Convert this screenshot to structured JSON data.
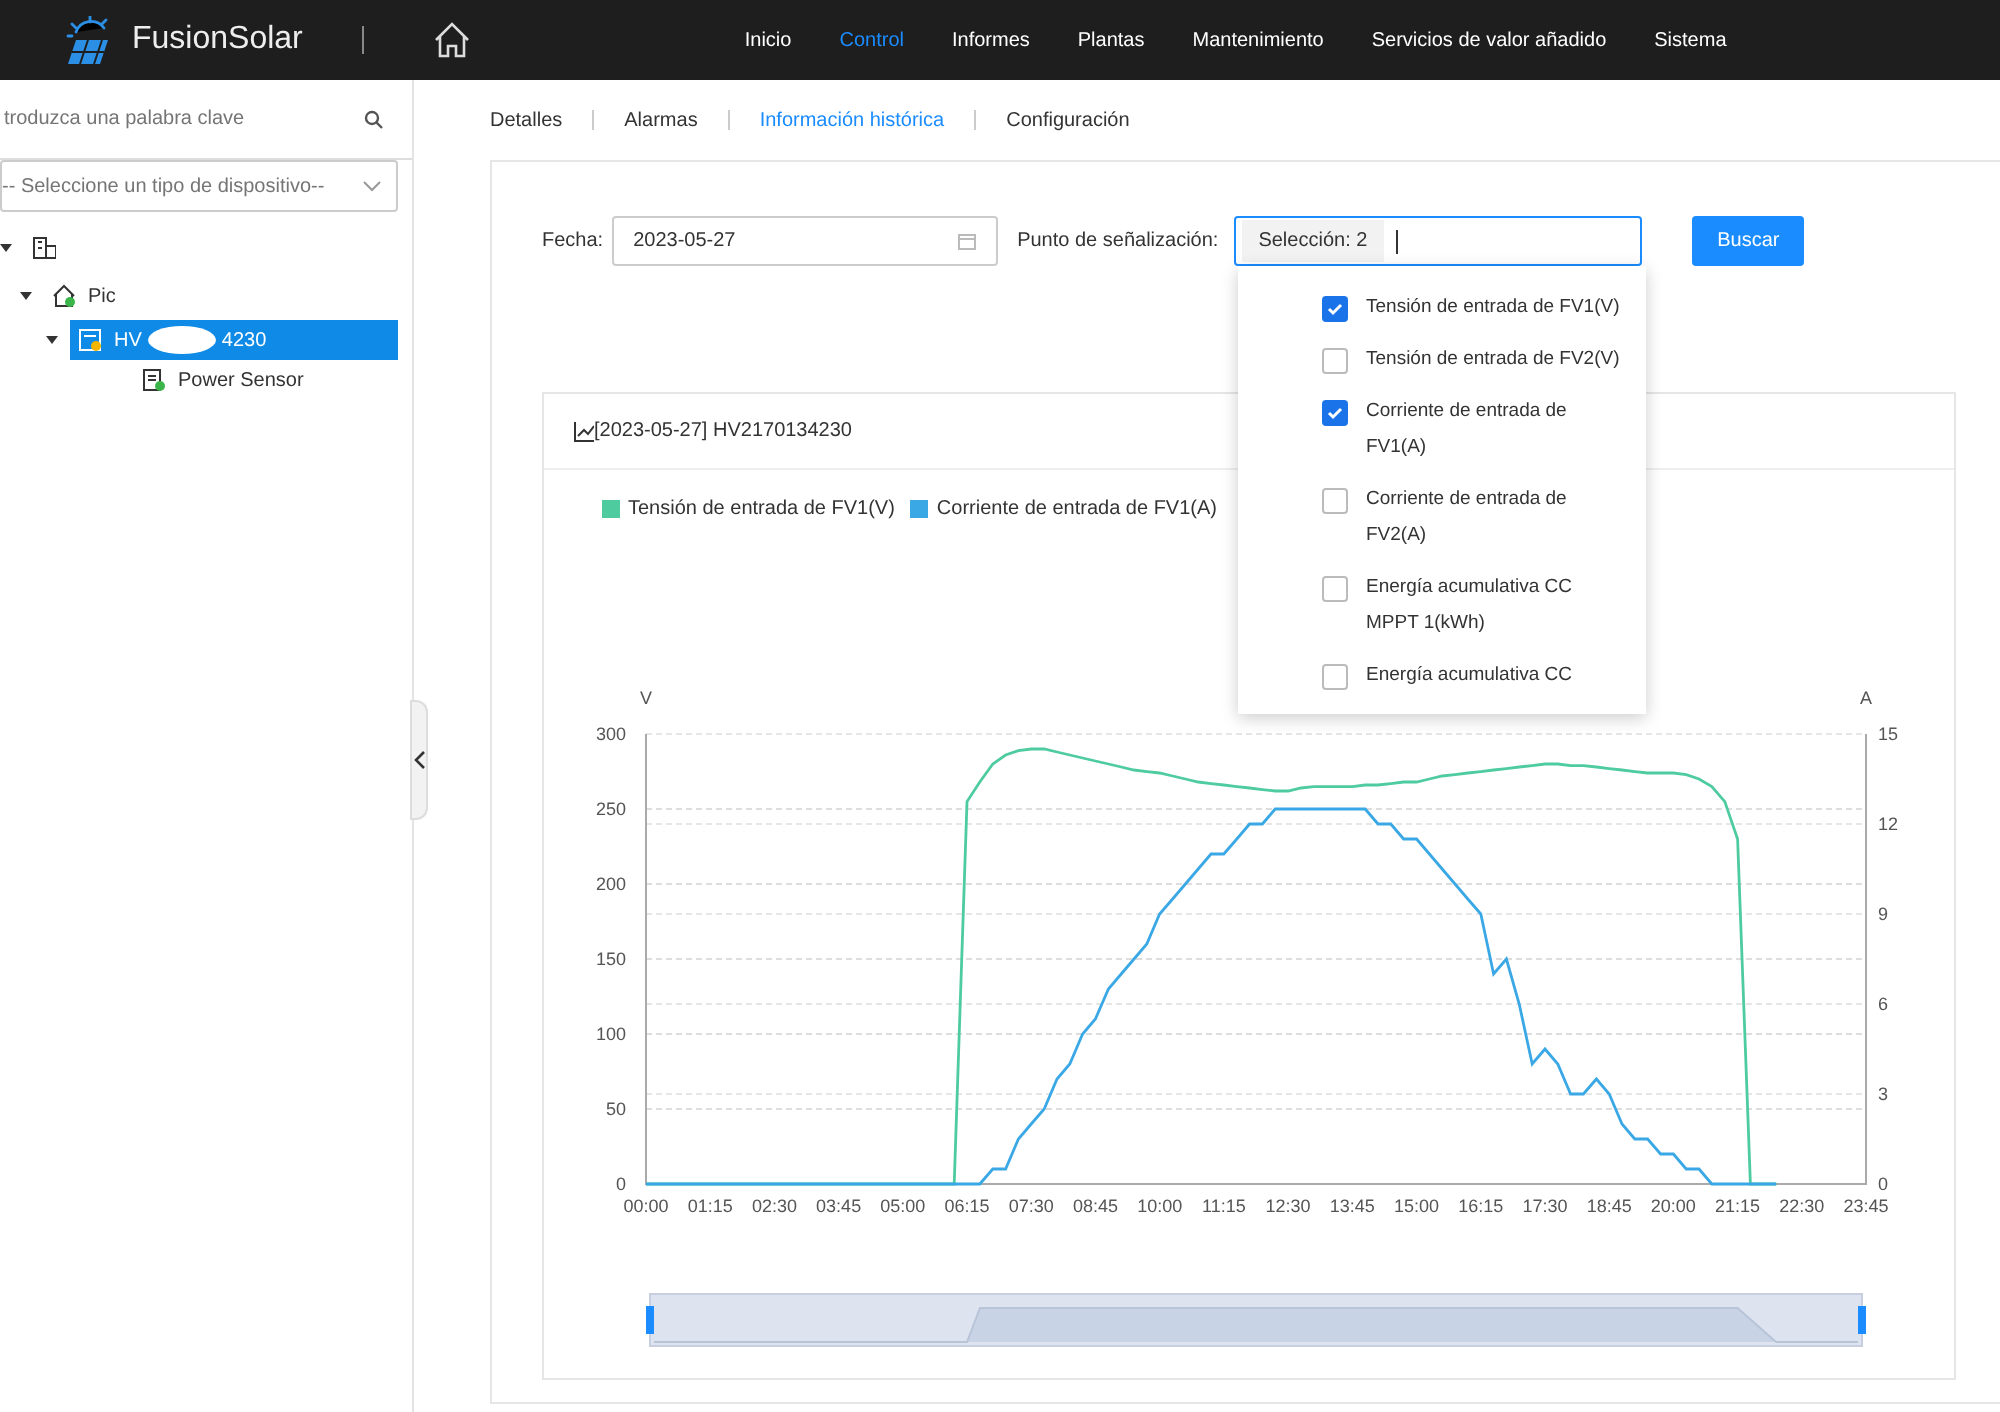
{
  "header": {
    "logo_text": "FusionSolar",
    "nav": [
      {
        "label": "Inicio",
        "selected": false
      },
      {
        "label": "Control",
        "selected": true
      },
      {
        "label": "Informes",
        "selected": false
      },
      {
        "label": "Plantas",
        "selected": false
      },
      {
        "label": "Mantenimiento",
        "selected": false
      },
      {
        "label": "Servicios de valor añadido",
        "selected": false
      },
      {
        "label": "Sistema",
        "selected": false
      }
    ]
  },
  "sidebar": {
    "search": {
      "placeholder": "troduzca una palabra clave"
    },
    "device_type": {
      "placeholder": "-- Seleccione un tipo de dispositivo--"
    },
    "tree": [
      {
        "kind": "building",
        "expanded": true,
        "selected": false,
        "children": [
          {
            "kind": "plant",
            "label": "Pic",
            "expanded": true,
            "selected": false,
            "children": [
              {
                "kind": "inverter",
                "label": "HV",
                "label_end": "4230",
                "expanded": true,
                "selected": true,
                "children": [
                  {
                    "kind": "sensor",
                    "label": "Power Sensor",
                    "selected": false
                  }
                ]
              }
            ]
          }
        ]
      }
    ]
  },
  "tabs": [
    {
      "label": "Detalles",
      "selected": false
    },
    {
      "label": "Alarmas",
      "selected": false
    },
    {
      "label": "Información histórica",
      "selected": true
    },
    {
      "label": "Configuración",
      "selected": false
    }
  ],
  "filters": {
    "date_label": "Fecha:",
    "date": "2023-05-27",
    "signal_label": "Punto de señalización:",
    "signal_value": "Selección: 2",
    "search_button": "Buscar",
    "options": [
      {
        "label": "Tensión de entrada de FV1(V)",
        "checked": true
      },
      {
        "label": "Tensión de entrada de FV2(V)",
        "checked": false
      },
      {
        "label": "Corriente de entrada de FV1(A)",
        "checked": true
      },
      {
        "label": "Corriente de entrada de FV2(A)",
        "checked": false
      },
      {
        "label": "Energía acumulativa CC MPPT 1(kWh)",
        "checked": false
      },
      {
        "label": "Energía acumulativa CC",
        "checked": false
      }
    ]
  },
  "chart_card": {
    "title": "[2023-05-27] HV2170134230",
    "chart_data": {
      "type": "line",
      "ylabel": "V",
      "y2label": "A",
      "ylim": [
        0,
        300
      ],
      "yticks": [
        0,
        50,
        100,
        150,
        200,
        250,
        300
      ],
      "y2lim": [
        0,
        15
      ],
      "y2ticks": [
        0,
        3,
        6,
        9,
        12,
        15
      ],
      "xlim": [
        0,
        23.75
      ],
      "grid": true,
      "xticks": [
        {
          "value": 0,
          "label": "00:00"
        },
        {
          "value": 1.25,
          "label": "01:15"
        },
        {
          "value": 2.5,
          "label": "02:30"
        },
        {
          "value": 3.75,
          "label": "03:45"
        },
        {
          "value": 5,
          "label": "05:00"
        },
        {
          "value": 6.25,
          "label": "06:15"
        },
        {
          "value": 7.5,
          "label": "07:30"
        },
        {
          "value": 8.75,
          "label": "08:45"
        },
        {
          "value": 10,
          "label": "10:00"
        },
        {
          "value": 11.25,
          "label": "11:15"
        },
        {
          "value": 12.5,
          "label": "12:30"
        },
        {
          "value": 13.75,
          "label": "13:45"
        },
        {
          "value": 15,
          "label": "15:00"
        },
        {
          "value": 16.25,
          "label": "16:15"
        },
        {
          "value": 17.5,
          "label": "17:30"
        },
        {
          "value": 18.75,
          "label": "18:45"
        },
        {
          "value": 20,
          "label": "20:00"
        },
        {
          "value": 21.25,
          "label": "21:15"
        },
        {
          "value": 22.5,
          "label": "22:30"
        },
        {
          "value": 23.75,
          "label": "23:45"
        }
      ],
      "x": [
        0,
        0.25,
        0.5,
        0.75,
        1,
        1.25,
        1.5,
        1.75,
        2,
        2.25,
        2.5,
        2.75,
        3,
        3.25,
        3.5,
        3.75,
        4,
        4.25,
        4.5,
        4.75,
        5,
        5.25,
        5.5,
        5.75,
        6,
        6.25,
        6.5,
        6.75,
        7,
        7.25,
        7.5,
        7.75,
        8,
        8.25,
        8.5,
        8.75,
        9,
        9.25,
        9.5,
        9.75,
        10,
        10.25,
        10.5,
        10.75,
        11,
        11.25,
        11.5,
        11.75,
        12,
        12.25,
        12.5,
        12.75,
        13,
        13.25,
        13.5,
        13.75,
        14,
        14.25,
        14.5,
        14.75,
        15,
        15.25,
        15.5,
        15.75,
        16,
        16.25,
        16.5,
        16.75,
        17,
        17.25,
        17.5,
        17.75,
        18,
        18.25,
        18.5,
        18.75,
        19,
        19.25,
        19.5,
        19.75,
        20,
        20.25,
        20.5,
        20.75,
        21,
        21.25,
        21.5,
        21.75,
        22
      ],
      "series": [
        {
          "name": "Tensión de entrada de FV1(V)",
          "color": "#4ecb9f",
          "values": [
            0,
            0,
            0,
            0,
            0,
            0,
            0,
            0,
            0,
            0,
            0,
            0,
            0,
            0,
            0,
            0,
            0,
            0,
            0,
            0,
            0,
            0,
            0,
            0,
            0,
            255,
            268,
            280,
            286,
            289,
            290,
            290,
            288,
            286,
            284,
            282,
            280,
            278,
            276,
            275,
            274,
            272,
            270,
            268,
            267,
            266,
            265,
            264,
            263,
            262,
            262,
            264,
            265,
            265,
            265,
            265,
            266,
            266,
            267,
            268,
            268,
            270,
            272,
            273,
            274,
            275,
            276,
            277,
            278,
            279,
            280,
            280,
            279,
            279,
            278,
            277,
            276,
            275,
            274,
            274,
            274,
            273,
            270,
            265,
            255,
            230,
            0,
            0,
            0
          ]
        },
        {
          "name": "Corriente de entrada de FV1(A)",
          "color": "#3ba8e6",
          "axis": "y2",
          "values": [
            0,
            0,
            0,
            0,
            0,
            0,
            0,
            0,
            0,
            0,
            0,
            0,
            0,
            0,
            0,
            0,
            0,
            0,
            0,
            0,
            0,
            0,
            0,
            0,
            0,
            0,
            0,
            0.5,
            0.5,
            1.5,
            2,
            2.5,
            3.5,
            4,
            5,
            5.5,
            6.5,
            7,
            7.5,
            8,
            9,
            9.5,
            10,
            10.5,
            11,
            11,
            11.5,
            12,
            12,
            12.5,
            12.5,
            12.5,
            12.5,
            12.5,
            12.5,
            12.5,
            12.5,
            12,
            12,
            11.5,
            11.5,
            11,
            10.5,
            10,
            9.5,
            9,
            7,
            7.5,
            6,
            4,
            4.5,
            4,
            3,
            3,
            3.5,
            3,
            2,
            1.5,
            1.5,
            1,
            1,
            0.5,
            0.5,
            0,
            0,
            0,
            0,
            0,
            0
          ]
        }
      ]
    }
  }
}
